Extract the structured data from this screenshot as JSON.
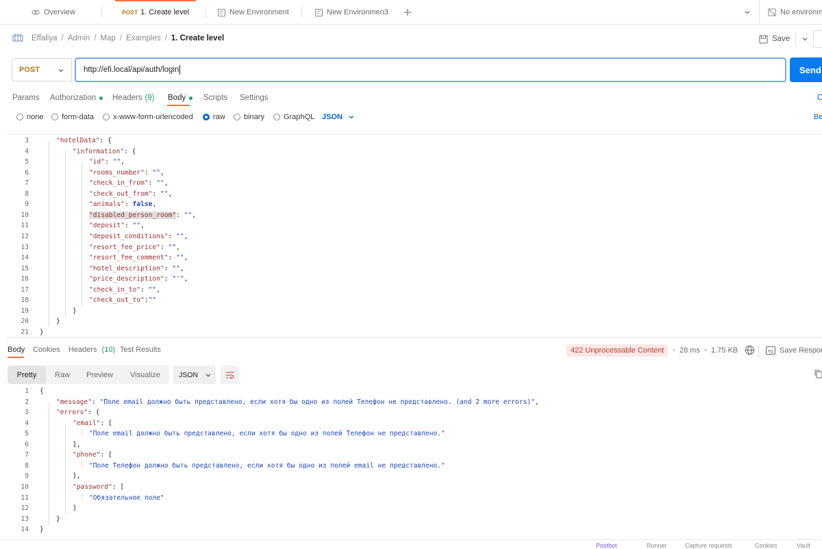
{
  "tabs": [
    {
      "label": "Overview",
      "icon": "overview-icon"
    },
    {
      "method": "POST",
      "label": "1. Create level",
      "unsaved": true
    },
    {
      "label": "New Environment",
      "icon": "environment-icon"
    },
    {
      "label": "New Environmen3",
      "icon": "environment-icon"
    }
  ],
  "env_selector": {
    "label": "No environment"
  },
  "breadcrumb": {
    "items": [
      "Effaliya",
      "Admin",
      "Map",
      "Examples"
    ],
    "current": "1. Create level",
    "separator": "/"
  },
  "save": {
    "label": "Save"
  },
  "request": {
    "method": "POST",
    "url": "http://efi.local/api/auth/login",
    "send_label": "Send"
  },
  "request_tabs": {
    "params": "Params",
    "authorization": "Authorization",
    "headers": "Headers",
    "headers_count": "(9)",
    "body": "Body",
    "scripts": "Scripts",
    "settings": "Settings",
    "cookies_partial": "C"
  },
  "body_options": {
    "none": "none",
    "form_data": "form-data",
    "urlencoded": "x-www-form-urlencoded",
    "raw": "raw",
    "binary": "binary",
    "graphql": "GraphQL",
    "format": "JSON",
    "beautify_partial": "Be"
  },
  "editor": {
    "lines": [
      {
        "n": "3",
        "text": "\"hotelData\": {"
      },
      {
        "n": "4",
        "text": "\"information\": {"
      },
      {
        "n": "5",
        "text": "\"id\": \"\","
      },
      {
        "n": "6",
        "text": "\"rooms_number\": \"\","
      },
      {
        "n": "7",
        "text": "\"check_in_from\": \"\","
      },
      {
        "n": "8",
        "text": "\"check_out_from\": \"\","
      },
      {
        "n": "9",
        "text": "\"animals\": false,"
      },
      {
        "n": "10",
        "text": "\"disabled_person_room\": \"\","
      },
      {
        "n": "11",
        "text": "\"deposit\": \"\","
      },
      {
        "n": "12",
        "text": "\"deposit_conditions\": \"\","
      },
      {
        "n": "13",
        "text": "\"resort_fee_price\": \"\","
      },
      {
        "n": "14",
        "text": "\"resort_fee_comment\": \"\","
      },
      {
        "n": "15",
        "text": "\"hotel_description\": \"\","
      },
      {
        "n": "16",
        "text": "\"price_description\": \"'\","
      },
      {
        "n": "17",
        "text": "\"check_in_to\": \"\","
      },
      {
        "n": "18",
        "text": "\"check_out_to\":\"\""
      },
      {
        "n": "19",
        "text": "}"
      },
      {
        "n": "20",
        "text": "}"
      },
      {
        "n": "21",
        "text": "}"
      }
    ]
  },
  "response_tabs": {
    "body": "Body",
    "cookies": "Cookies",
    "headers": "Headers",
    "headers_count": "(10)",
    "test_results": "Test Results"
  },
  "response_meta": {
    "status": "422 Unprocessable Content",
    "time": "28 ms",
    "size": "1.75 KB",
    "save_response": "Save Respon"
  },
  "view_modes": {
    "pretty": "Pretty",
    "raw": "Raw",
    "preview": "Preview",
    "visualize": "Visualize",
    "format": "JSON"
  },
  "response": {
    "lines": [
      {
        "n": "1",
        "text": "{"
      },
      {
        "n": "2",
        "text": "\"message\": \"Поле email должно быть представлено, если хотя бы одно из полей Телефон не представлено. (and 2 more errors)\","
      },
      {
        "n": "3",
        "text": "\"errors\": {"
      },
      {
        "n": "4",
        "text": "\"email\": ["
      },
      {
        "n": "5",
        "text": "\"Поле email должно быть представлено, если хотя бы одно из полей Телефон не представлено.\""
      },
      {
        "n": "6",
        "text": "],"
      },
      {
        "n": "7",
        "text": "\"phone\": ["
      },
      {
        "n": "8",
        "text": "\"Поле Телефон должно быть представлено, если хотя бы одно из полей email не представлено.\""
      },
      {
        "n": "9",
        "text": "],"
      },
      {
        "n": "10",
        "text": "\"password\": ["
      },
      {
        "n": "11",
        "text": "\"Обязательное поле\""
      },
      {
        "n": "12",
        "text": "]"
      },
      {
        "n": "13",
        "text": "}"
      },
      {
        "n": "14",
        "text": "}"
      }
    ]
  },
  "footer": {
    "postbot": "Postbot",
    "runner": "Runner",
    "capture": "Capture requests",
    "cookies": "Cookies",
    "vault": "Vault"
  },
  "colors": {
    "accent": "#ff6c37",
    "send": "#097bed",
    "method": "#b7791f",
    "status_bg": "#fde7e5",
    "status_text": "#c0392b",
    "key": "#9e2f2f",
    "string": "#1d47b5"
  }
}
